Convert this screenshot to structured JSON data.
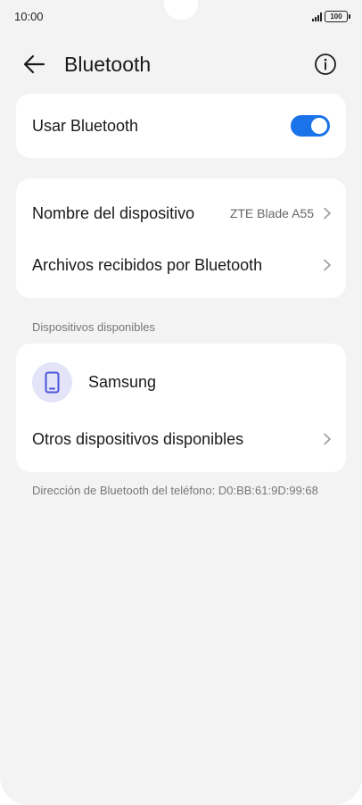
{
  "status_bar": {
    "time": "10:00",
    "battery": "100"
  },
  "header": {
    "title": "Bluetooth",
    "back_icon": "arrow-left-icon",
    "info_icon": "info-circle-icon"
  },
  "bluetooth_toggle": {
    "label": "Usar Bluetooth",
    "enabled": true,
    "accent_color": "#1a73e8"
  },
  "device_settings": {
    "name_label": "Nombre del dispositivo",
    "name_value": "ZTE Blade A55",
    "received_files_label": "Archivos recibidos por Bluetooth"
  },
  "available_devices": {
    "section_title": "Dispositivos disponibles",
    "devices": [
      {
        "name": "Samsung",
        "icon": "phone-icon"
      }
    ],
    "other_devices_label": "Otros dispositivos disponibles"
  },
  "footer": {
    "address_text": "Dirección de Bluetooth del teléfono: D0:BB:61:9D:99:68"
  }
}
